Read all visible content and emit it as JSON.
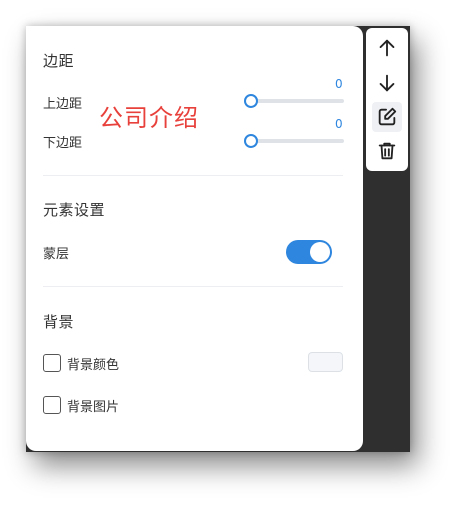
{
  "panel": {
    "margin_section": {
      "title": "边距",
      "top": {
        "label": "上边距",
        "value": "0",
        "level": 0
      },
      "bottom": {
        "label": "下边距",
        "value": "0",
        "level": 0
      }
    },
    "element_section": {
      "title": "元素设置",
      "mask": {
        "label": "蒙层",
        "enabled": true
      }
    },
    "background_section": {
      "title": "背景",
      "color": {
        "label": "背景颜色",
        "checked": false
      },
      "image": {
        "label": "背景图片",
        "checked": false
      }
    }
  },
  "overlay": {
    "text": "公司介绍"
  },
  "toolbar": {
    "icons": [
      "arrow-up-icon",
      "arrow-down-icon",
      "edit-icon",
      "trash-icon"
    ]
  },
  "colors": {
    "accent": "#2e86de",
    "overlay_text": "#e8413c",
    "backdrop": "#2f2f2f"
  }
}
